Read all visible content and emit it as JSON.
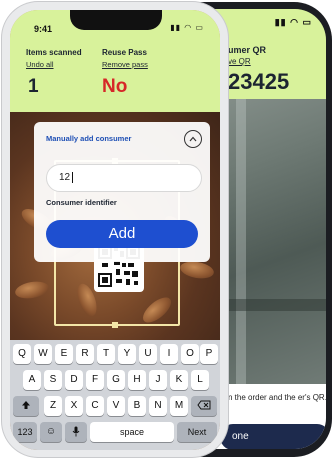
{
  "back_phone": {
    "header_label": "umer QR",
    "header_link": "ve QR",
    "header_value": "23425",
    "bottom_text": "n the order and the er's QR.",
    "button_label": "one"
  },
  "front_phone": {
    "status_time": "9:41",
    "items_scanned": {
      "label": "Items scanned",
      "link": "Undo all",
      "value": "1"
    },
    "reuse_pass": {
      "label": "Reuse Pass",
      "link": "Remove pass",
      "value": "No"
    },
    "panel": {
      "title": "Manually add consumer",
      "input_value": "12",
      "input_label": "Consumer identifier",
      "add_label": "Add"
    },
    "keyboard": {
      "row1": [
        "Q",
        "W",
        "E",
        "R",
        "T",
        "Y",
        "U",
        "I",
        "O",
        "P"
      ],
      "row2": [
        "A",
        "S",
        "D",
        "F",
        "G",
        "H",
        "J",
        "K",
        "L"
      ],
      "row3": [
        "Z",
        "X",
        "C",
        "V",
        "B",
        "N",
        "M"
      ],
      "numbers_label": "123",
      "space_label": "space",
      "next_label": "Next"
    }
  },
  "colors": {
    "header_bg": "#d8f29b",
    "accent_blue": "#1e4fd0",
    "no_red": "#d62828",
    "navy": "#1c2431"
  }
}
